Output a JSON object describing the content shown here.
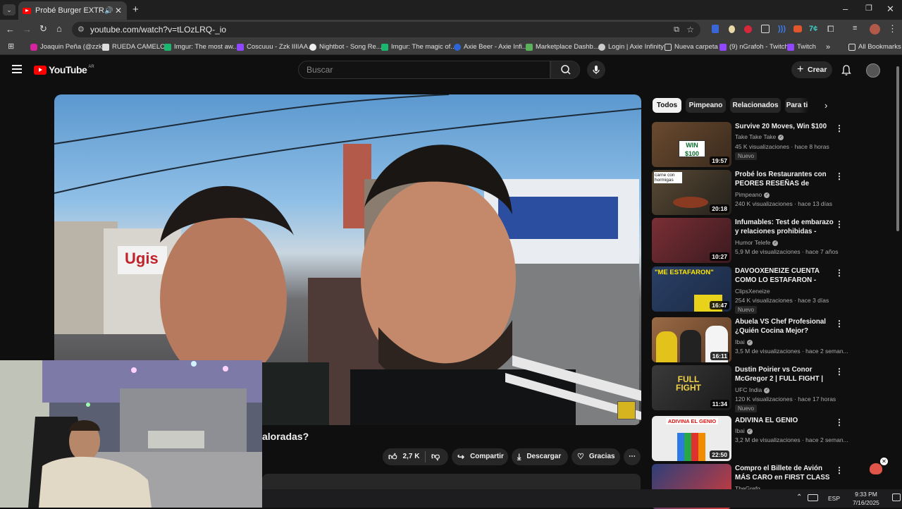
{
  "browser": {
    "tab_title": "Probé Burger EXTREMAS p",
    "url": "youtube.com/watch?v=tLOzLRQ-_io",
    "bookmarks": [
      "Joaquin Peña (@zzk...",
      "RUEDA CAMELOT",
      "Imgur: The most aw...",
      "Coscuuu - Zzk IIIIAA...",
      "Nightbot - Song Re...",
      "Imgur: The magic of...",
      "Axie Beer - Axie Infi...",
      "Marketplace Dashb...",
      "Login | Axie Infinity",
      "Nueva carpeta",
      "(9) nGrafoh - Twitch",
      "Twitch"
    ],
    "all_bookmarks": "All Bookmarks"
  },
  "header": {
    "logo_text": "YouTube",
    "region": "AR",
    "search_placeholder": "Buscar",
    "create_label": "Crear"
  },
  "video": {
    "title_partial": "aloradas?",
    "likes": "2,7 K",
    "share_label": "Compartir",
    "download_label": "Descargar",
    "thanks_label": "Gracias"
  },
  "chips": [
    "Todos",
    "Pimpeano",
    "Relacionados",
    "Para ti"
  ],
  "recommendations": [
    {
      "title": "Survive 20 Moves, Win $100",
      "channel": "Take Take Take",
      "views": "45 K visualizaciones · hace 8 horas",
      "duration": "19:57",
      "badge": "Nuevo",
      "thumb_text": "WIN $100",
      "color": "#6a4a2f"
    },
    {
      "title": "Probé los Restaurantes con PEORES RESEÑAS de Buenos ...",
      "channel": "Pimpeano",
      "views": "240 K visualizaciones · hace 13 días",
      "duration": "20:18",
      "badge": "",
      "thumb_text": "carne con hormigas",
      "color": "#3c3a33"
    },
    {
      "title": "Infumables: Test de embarazo y relaciones prohibidas - Peligro...",
      "channel": "Humor Telefe",
      "views": "5,9 M de visualizaciones · hace 7 años",
      "duration": "10:27",
      "badge": "",
      "thumb_text": "",
      "color": "#6b2a2e"
    },
    {
      "title": "DAVOOXENEIZE CUENTA COMO LO ESTAFARON - ANECDOTA",
      "channel": "ClipsXeneize",
      "views": "254 K visualizaciones · hace 3 días",
      "duration": "16:47",
      "badge": "Nuevo",
      "thumb_text": "\"ME ESTAFARON\"",
      "color": "#2a3f66"
    },
    {
      "title": "Abuela VS Chef Profesional ¿Quién Cocina Mejor?",
      "channel": "Ibai",
      "views": "3,5 M de visualizaciones · hace 2 seman...",
      "duration": "16:11",
      "badge": "",
      "thumb_text": "",
      "color": "#8a5a3a"
    },
    {
      "title": "Dustin Poirier vs Conor McGregor 2 | FULL FIGHT | UF...",
      "channel": "UFC India",
      "views": "120 K visualizaciones · hace 17 horas",
      "duration": "11:34",
      "badge": "Nuevo",
      "thumb_text": "FULL FIGHT",
      "color": "#2b2b2b"
    },
    {
      "title": "ADIVINA EL GENIO",
      "channel": "Ibai",
      "views": "3,2 M de visualizaciones · hace 2 seman...",
      "duration": "22:50",
      "badge": "",
      "thumb_text": "ADIVINA EL GENIO",
      "color": "#e9e9e9"
    },
    {
      "title": "Compro el Billete de Avión MÁS CARO en FIRST CLASS de ...",
      "channel": "TheGrefg",
      "views": "",
      "duration": "",
      "badge": "",
      "thumb_text": "",
      "color": "#2d3f7a"
    }
  ],
  "taskbar": {
    "lang": "ESP",
    "time": "9:33 PM",
    "date": "7/16/2025"
  }
}
